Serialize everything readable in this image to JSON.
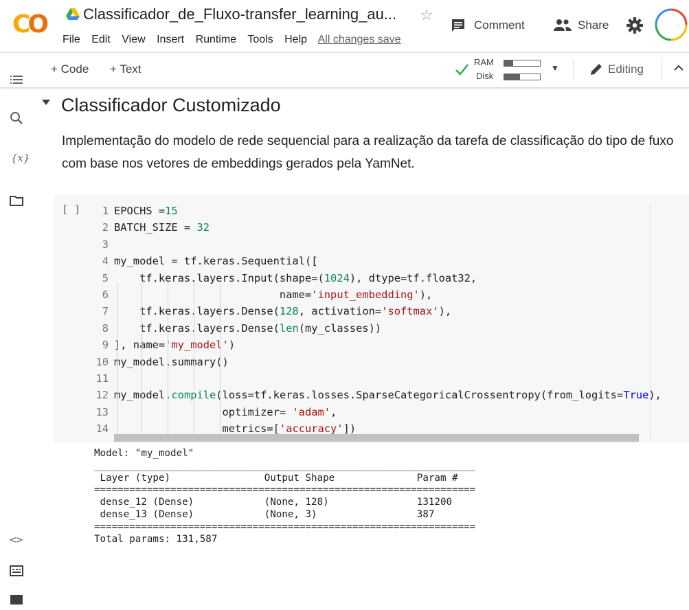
{
  "app": {
    "doc_title": "Classificador_de_Fluxo-transfer_learning_au...",
    "menu": [
      "File",
      "Edit",
      "View",
      "Insert",
      "Runtime",
      "Tools",
      "Help"
    ],
    "save_status": "All changes save",
    "comment_label": "Comment",
    "share_label": "Share"
  },
  "toolbar": {
    "add_code": "+ Code",
    "add_text": "+ Text",
    "ram_label": "RAM",
    "disk_label": "Disk",
    "ram_usage_fraction": 0.25,
    "disk_usage_fraction": 0.45,
    "editing_label": "Editing"
  },
  "section": {
    "title": "Classificador Customizado",
    "description": "Implementação do modelo de rede sequencial para a realização da tarefa de classificação do tipo de fuxo com base nos vetores de embeddings gerados pela YamNet."
  },
  "cell": {
    "run_brackets": "[ ]",
    "line_numbers": [
      "1",
      "2",
      "3",
      "4",
      "5",
      "6",
      "7",
      "8",
      "9",
      "10",
      "11",
      "12",
      "13",
      "14"
    ],
    "code_lines": [
      "EPOCHS =15",
      "BATCH_SIZE = 32",
      "",
      "my_model = tf.keras.Sequential([",
      "    tf.keras.layers.Input(shape=(1024), dtype=tf.float32,",
      "                          name='input_embedding'),",
      "    tf.keras.layers.Dense(128, activation='softmax'),",
      "    tf.keras.layers.Dense(len(my_classes))",
      "], name='my_model')",
      "my_model.summary()",
      "",
      "my_model.compile(loss=tf.keras.losses.SparseCategoricalCrossentropy(from_logits=True),",
      "                 optimizer= 'adam',",
      "                 metrics=['accuracy'])"
    ]
  },
  "output": {
    "model_line": "Model: \"my_model\"",
    "rule": "_________________________________________________________________",
    "header": " Layer (type)                Output Shape              Param #   ",
    "double_rule": "=================================================================",
    "rows": [
      " dense_12 (Dense)            (None, 128)               131200    ",
      "",
      " dense_13 (Dense)            (None, 3)                 387       ",
      ""
    ],
    "total": "Total params: 131,587"
  },
  "colors": {
    "logo_yellow": "#F9AB00",
    "logo_orange": "#E8710A",
    "check_green": "#34A853",
    "code_number": "#098658",
    "code_string": "#a31515",
    "code_keyword": "#0000ff"
  }
}
